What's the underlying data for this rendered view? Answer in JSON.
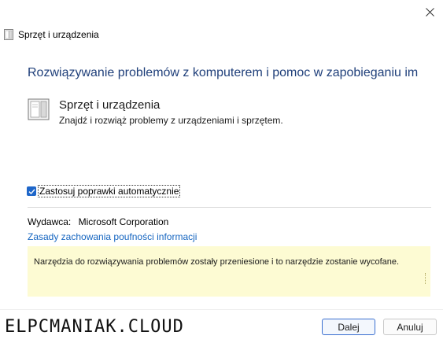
{
  "window": {
    "title": "Sprzęt i urządzenia"
  },
  "main": {
    "heading": "Rozwiązywanie problemów z komputerem i pomoc w zapobieganiu im",
    "troubleshooter": {
      "title": "Sprzęt i urządzenia",
      "description": "Znajdź i rozwiąż problemy z urządzeniami i sprzętem."
    },
    "autofix": {
      "label": "Zastosuj poprawki automatycznie",
      "checked": true
    },
    "publisher": {
      "label": "Wydawca:",
      "value": "Microsoft Corporation"
    },
    "privacy_link": "Zasady zachowania poufności informacji",
    "notice": "Narzędzia do rozwiązywania problemów zostały przeniesione i to narzędzie zostanie wycofane."
  },
  "footer": {
    "watermark": "ELPCMANIAK.CLOUD",
    "next_label": "Dalej",
    "cancel_label": "Anuluj"
  },
  "colors": {
    "heading": "#1f3f7a",
    "link": "#1565c0",
    "notice_bg": "#fdfbd3",
    "checkbox": "#1e66c9"
  }
}
